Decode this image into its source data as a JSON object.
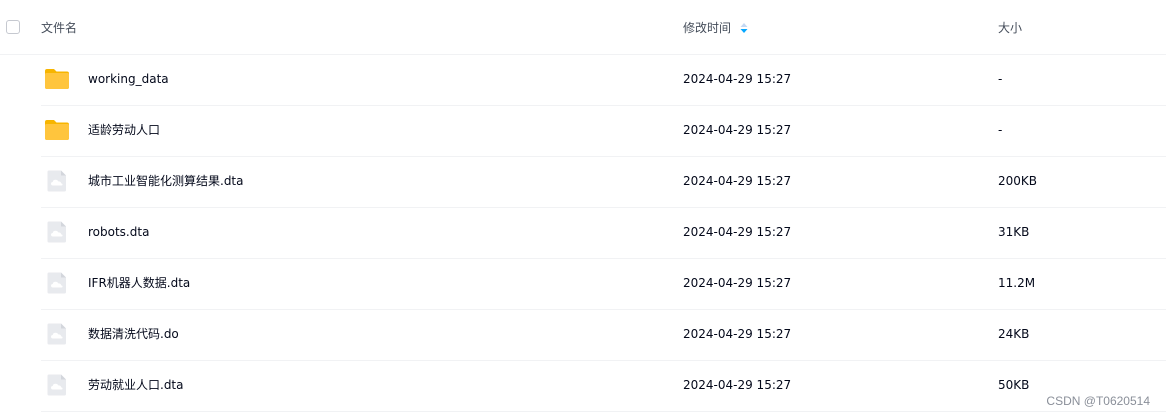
{
  "header": {
    "name_label": "文件名",
    "time_label": "修改时间",
    "size_label": "大小"
  },
  "rows": [
    {
      "icon": "folder-icon",
      "name": "working_data",
      "time": "2024-04-29 15:27",
      "size": "-"
    },
    {
      "icon": "folder-icon",
      "name": "适龄劳动人口",
      "time": "2024-04-29 15:27",
      "size": "-"
    },
    {
      "icon": "cloud-file-icon",
      "name": "城市工业智能化测算结果.dta",
      "time": "2024-04-29 15:27",
      "size": "200KB"
    },
    {
      "icon": "cloud-file-icon",
      "name": "robots.dta",
      "time": "2024-04-29 15:27",
      "size": "31KB"
    },
    {
      "icon": "cloud-file-icon",
      "name": "IFR机器人数据.dta",
      "time": "2024-04-29 15:27",
      "size": "11.2M"
    },
    {
      "icon": "cloud-file-icon",
      "name": "数据清洗代码.do",
      "time": "2024-04-29 15:27",
      "size": "24KB"
    },
    {
      "icon": "cloud-file-icon",
      "name": "劳动就业人口.dta",
      "time": "2024-04-29 15:27",
      "size": "50KB"
    }
  ],
  "watermark": "CSDN @T0620514",
  "colors": {
    "folder": "#ffc53d",
    "file_icon_bg": "#e8eaee",
    "sort_active": "#06a7ff",
    "sort_inactive": "#c4d8f3"
  }
}
